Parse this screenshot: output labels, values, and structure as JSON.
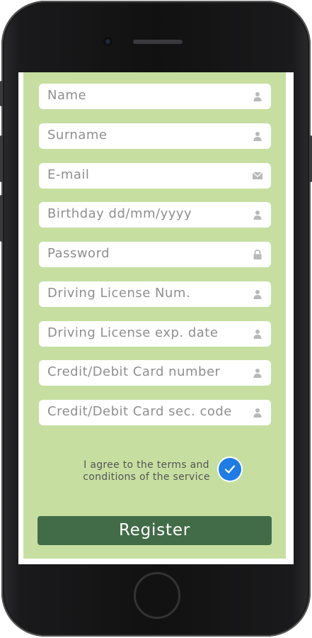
{
  "form": {
    "fields": [
      {
        "placeholder": "Name",
        "icon": "person-icon"
      },
      {
        "placeholder": "Surname",
        "icon": "person-icon"
      },
      {
        "placeholder": "E-mail",
        "icon": "envelope-icon"
      },
      {
        "placeholder": "Birthday dd/mm/yyyy",
        "icon": "person-icon"
      },
      {
        "placeholder": "Password",
        "icon": "lock-icon"
      },
      {
        "placeholder": "Driving License Num.",
        "icon": "person-icon"
      },
      {
        "placeholder": "Driving License exp. date",
        "icon": "person-icon"
      },
      {
        "placeholder": "Credit/Debit Card number",
        "icon": "person-icon"
      },
      {
        "placeholder": "Credit/Debit Card sec. code",
        "icon": "person-icon"
      }
    ],
    "agree_text": "I agree to the terms and conditions of the service",
    "agree_checked": true,
    "register_label": "Register"
  },
  "colors": {
    "panel_bg": "#c6dfa1",
    "register_bg": "#426c48",
    "checkbox": "#1e7ce6",
    "placeholder": "#8f8f8f"
  }
}
